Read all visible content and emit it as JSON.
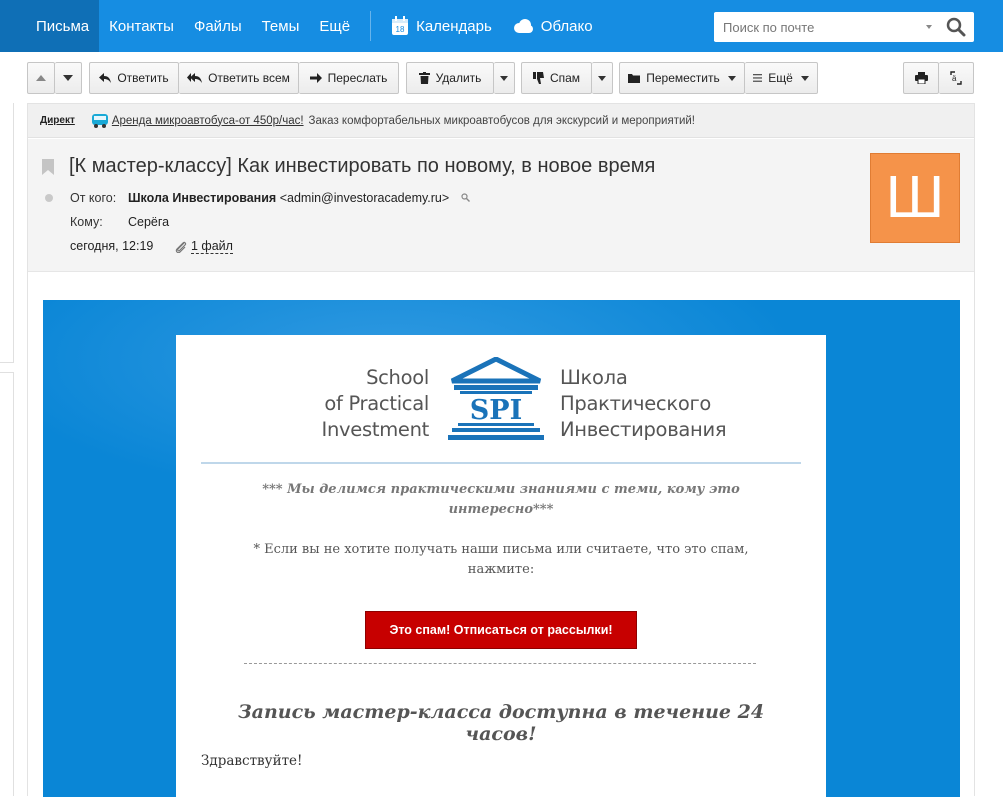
{
  "nav": {
    "items": [
      {
        "label": "Письма",
        "active": true
      },
      {
        "label": "Контакты"
      },
      {
        "label": "Файлы"
      },
      {
        "label": "Темы"
      },
      {
        "label": "Ещё"
      }
    ],
    "calendar": {
      "label": "Календарь",
      "day": "18"
    },
    "cloud": {
      "label": "Облако"
    },
    "search": {
      "placeholder": "Поиск по почте"
    }
  },
  "toolbar": {
    "reply": "Ответить",
    "reply_all": "Ответить всем",
    "forward": "Переслать",
    "delete": "Удалить",
    "spam": "Спам",
    "move": "Переместить",
    "more": "Ещё"
  },
  "direct": {
    "label": "Директ",
    "link": "Аренда микроавтобуса-от 450р/час!",
    "text": "Заказ комфортабельных микроавтобусов для экскурсий и мероприятий!"
  },
  "message": {
    "subject": "[К мастер-классу] Как инвестировать по новому, в новое время",
    "from_label": "От кого:",
    "from_name": "Школа Инвестирования",
    "from_email": "<admin@investoracademy.ru>",
    "to_label": "Кому:",
    "to_name": "Серёга",
    "date": "сегодня, 12:19",
    "attachments": "1 файл",
    "avatar_letter": "Ш"
  },
  "email": {
    "logo_en": [
      "School",
      "of Practical",
      "Investment"
    ],
    "logo_ru": [
      "Школа",
      "Практического",
      "Инвестирования"
    ],
    "logo_mark": "SPI",
    "share_line_1": "*** Мы делимся практическими знаниями с теми, кому это",
    "share_line_2": "интересно***",
    "unsub_line_1": "* Если вы  не хотите получать наши письма или считаете, что это спам,",
    "unsub_line_2": "нажмите:",
    "spam_button": "Это спам! Отписаться от рассылки!",
    "headline": "Запись мастер-класса доступна в течение 24 часов!",
    "greeting": "Здравствуйте!"
  },
  "colors": {
    "nav_bg": "#168de2",
    "nav_active": "#0f6fb6",
    "email_blue": "#0a86d6",
    "spam_red": "#c70000",
    "avatar_orange": "#f5934a"
  }
}
